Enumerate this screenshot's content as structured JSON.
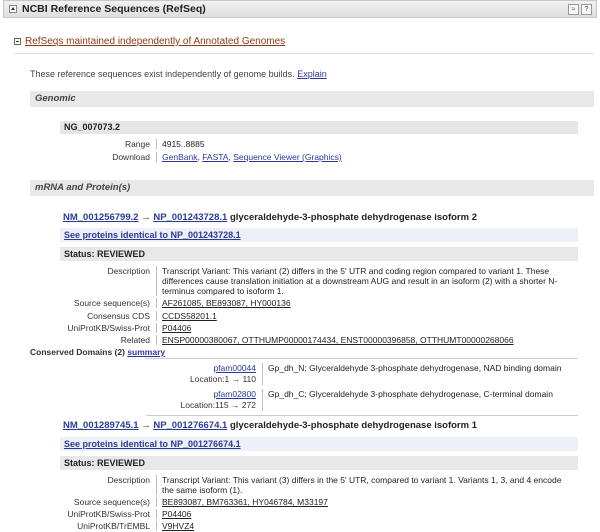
{
  "header": {
    "title": "NCBI Reference Sequences (RefSeq)",
    "btn1": "≈",
    "btn2": "?"
  },
  "subsection": {
    "label": "RefSeqs maintained independently of Annotated Genomes"
  },
  "intro": {
    "text": "These reference sequences exist independently of genome builds.",
    "link": "Explain"
  },
  "genomic": {
    "title": "Genomic",
    "accession": "NG_007073.2",
    "range_label": "Range",
    "range_value": "4915..8885",
    "download_label": "Download",
    "download_links": [
      "GenBank",
      "FASTA",
      "Sequence Viewer (Graphics)"
    ]
  },
  "mrna": {
    "title": "mRNA and Protein(s)",
    "entries": [
      {
        "mrna_acc": "NM_001256799.2",
        "arrow": "→",
        "prot_acc": "NP_001243728.1",
        "name": "glyceraldehyde-3-phosphate dehydrogenase isoform 2",
        "identical": "See proteins identical to NP_001243728.1",
        "status": "Status: REVIEWED",
        "desc_label": "Description",
        "desc": "Transcript Variant: This variant (2) differs in the 5' UTR and coding region compared to variant 1. These differences cause translation initiation at a downstream AUG and result in an isoform (2) with a shorter N-terminus compared to isoform 1.",
        "source_label": "Source sequence(s)",
        "source": "AF261085, BE893087, HY000136",
        "ccds_label": "Consensus CDS",
        "ccds": "CCDS58201.1",
        "uniprot_label": "UniProtKB/Swiss-Prot",
        "uniprot": "P04406",
        "related_label": "Related",
        "related": "ENSP00000380067, OTTHUMP00000174434, ENST00000396858, OTTHUMT00000268066",
        "domains_label": "Conserved Domains (2)",
        "domains_link": "summary",
        "domains": [
          {
            "id": "pfam00044",
            "loc": "Location:1 → 110",
            "desc": "Gp_dh_N; Glyceraldehyde 3-phosphate dehydrogenase, NAD binding domain"
          },
          {
            "id": "pfam02800",
            "loc": "Location:115 → 272",
            "desc": "Gp_dh_C; Glyceraldehyde 3-phosphate dehydrogenase, C-terminal domain"
          }
        ]
      },
      {
        "mrna_acc": "NM_001289745.1",
        "arrow": "→",
        "prot_acc": "NP_001276674.1",
        "name": "glyceraldehyde-3-phosphate dehydrogenase isoform 1",
        "identical": "See proteins identical to NP_001276674.1",
        "status": "Status: REVIEWED",
        "desc_label": "Description",
        "desc": "Transcript Variant: This variant (3) differs in the 5' UTR, compared to variant 1. Variants 1, 3, and 4 encode the same isoform (1).",
        "source_label": "Source sequence(s)",
        "source": "BE893087, BM763361, HY046784, M33197",
        "uniprot_label": "UniProtKB/Swiss-Prot",
        "uniprot": "P04406",
        "trembl_label": "UniProtKB/TrEMBL",
        "trembl": "V9HVZ4"
      }
    ]
  }
}
